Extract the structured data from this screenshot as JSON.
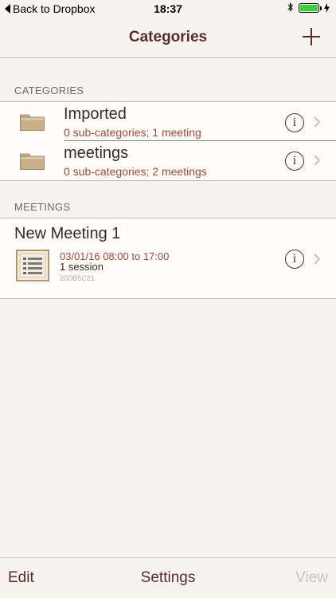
{
  "status_bar": {
    "back_label": "Back to Dropbox",
    "time": "18:37"
  },
  "nav": {
    "title": "Categories",
    "add_icon": "plus-icon"
  },
  "categories": {
    "header": "CATEGORIES",
    "items": [
      {
        "name": "Imported",
        "subtitle": "0 sub-categories; 1 meeting"
      },
      {
        "name": "meetings",
        "subtitle": "0 sub-categories; 2 meetings"
      }
    ]
  },
  "meetings": {
    "header": "MEETINGS",
    "items": [
      {
        "title": "New Meeting 1",
        "date": "03/01/16 08:00 to 17:00",
        "sessions": "1 session",
        "id": "20DB5C21"
      }
    ]
  },
  "toolbar": {
    "edit_label": "Edit",
    "settings_label": "Settings",
    "view_label": "View"
  },
  "colors": {
    "accent": "#5a2b2b",
    "subtitle": "#9b4a36",
    "battery": "#3ccf3c"
  }
}
